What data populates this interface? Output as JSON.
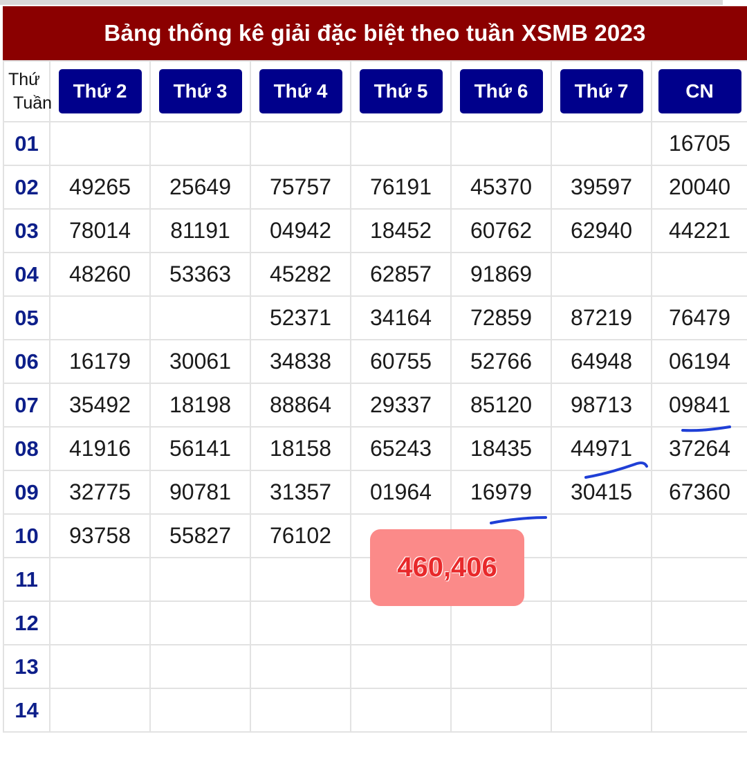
{
  "title": "Bảng thống kê giải đặc biệt theo tuần XSMB 2023",
  "corner": {
    "line1": "Thứ",
    "line2": "Tuần"
  },
  "days": [
    "Thứ 2",
    "Thứ 3",
    "Thứ 4",
    "Thứ 5",
    "Thứ 6",
    "Thứ 7",
    "CN"
  ],
  "weeks": [
    {
      "week": "01",
      "values": [
        "",
        "",
        "",
        "",
        "",
        "",
        "16705"
      ]
    },
    {
      "week": "02",
      "values": [
        "49265",
        "25649",
        "75757",
        "76191",
        "45370",
        "39597",
        "20040"
      ]
    },
    {
      "week": "03",
      "values": [
        "78014",
        "81191",
        "04942",
        "18452",
        "60762",
        "62940",
        "44221"
      ]
    },
    {
      "week": "04",
      "values": [
        "48260",
        "53363",
        "45282",
        "62857",
        "91869",
        "",
        ""
      ]
    },
    {
      "week": "05",
      "values": [
        "",
        "",
        "52371",
        "34164",
        "72859",
        "87219",
        "76479"
      ]
    },
    {
      "week": "06",
      "values": [
        "16179",
        "30061",
        "34838",
        "60755",
        "52766",
        "64948",
        "06194"
      ]
    },
    {
      "week": "07",
      "values": [
        "35492",
        "18198",
        "88864",
        "29337",
        "85120",
        "98713",
        "09841"
      ]
    },
    {
      "week": "08",
      "values": [
        "41916",
        "56141",
        "18158",
        "65243",
        "18435",
        "44971",
        "37264"
      ]
    },
    {
      "week": "09",
      "values": [
        "32775",
        "90781",
        "31357",
        "01964",
        "16979",
        "30415",
        "67360"
      ]
    },
    {
      "week": "10",
      "values": [
        "93758",
        "55827",
        "76102",
        "",
        "",
        "",
        ""
      ]
    },
    {
      "week": "11",
      "values": [
        "",
        "",
        "",
        "",
        "",
        "",
        ""
      ]
    },
    {
      "week": "12",
      "values": [
        "",
        "",
        "",
        "",
        "",
        "",
        ""
      ]
    },
    {
      "week": "13",
      "values": [
        "",
        "",
        "",
        "",
        "",
        "",
        ""
      ]
    },
    {
      "week": "14",
      "values": [
        "",
        "",
        "",
        "",
        "",
        "",
        ""
      ]
    }
  ],
  "overlay": {
    "total": "460,406"
  },
  "colors": {
    "title_bg": "#8b0000",
    "day_button_bg": "#00008b",
    "week_number": "#0d1f8a",
    "overlay_bg": "#fb8a89",
    "overlay_text": "#e8292b",
    "annotation_stroke": "#1f3fd6"
  }
}
